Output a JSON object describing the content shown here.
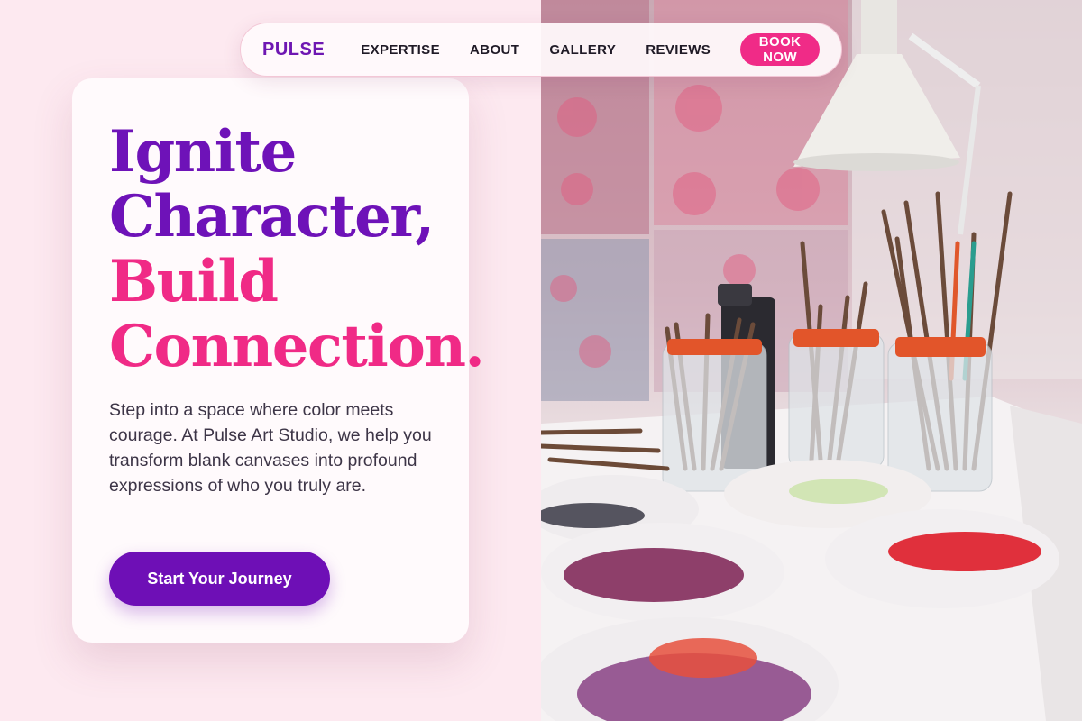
{
  "brand": {
    "logo": "PULSE",
    "colors": {
      "purple": "#6e12b8",
      "pink": "#f02a86",
      "background": "#fde9f0"
    }
  },
  "nav": {
    "links": [
      {
        "label": "EXPERTISE"
      },
      {
        "label": "ABOUT"
      },
      {
        "label": "GALLERY"
      },
      {
        "label": "REVIEWS"
      }
    ],
    "cta": "BOOK NOW"
  },
  "hero": {
    "headline_lines": [
      {
        "text": "Ignite",
        "color": "purple"
      },
      {
        "text": "Character,",
        "color": "purple"
      },
      {
        "text": "Build",
        "color": "pink"
      },
      {
        "text": "Connection.",
        "color": "pink"
      }
    ],
    "lead": "Step into a space where color meets courage. At Pulse Art Studio, we help you transform blank canvases into profound expressions of who you truly are.",
    "cta": "Start Your Journey"
  },
  "photo": {
    "subject": "art-studio-brushes-and-paint-palettes"
  }
}
